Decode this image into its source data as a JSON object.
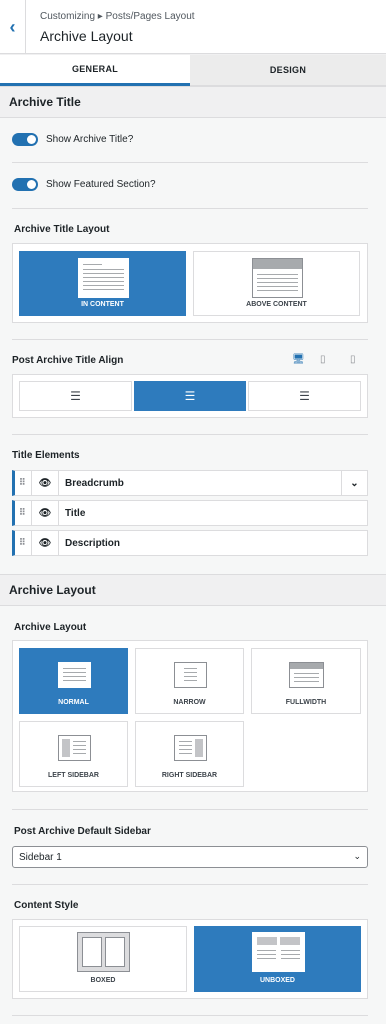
{
  "header": {
    "breadcrumb": "Customizing ▸ Posts/Pages Layout",
    "title": "Archive Layout",
    "back_icon": "chevron-left-icon"
  },
  "tabs": [
    {
      "label": "GENERAL",
      "active": true
    },
    {
      "label": "DESIGN",
      "active": false
    }
  ],
  "archive_title": {
    "section_title": "Archive Title",
    "show_archive_title": {
      "label": "Show Archive Title?",
      "on": true
    },
    "show_featured_section": {
      "label": "Show Featured Section?",
      "on": true
    },
    "layout": {
      "label": "Archive Title Layout",
      "options": [
        {
          "label": "IN CONTENT",
          "selected": true
        },
        {
          "label": "ABOVE CONTENT",
          "selected": false
        }
      ]
    },
    "align": {
      "label": "Post Archive Title Align",
      "options": [
        "left",
        "center",
        "right"
      ],
      "selected": "center",
      "devices": [
        "desktop-icon",
        "tablet-icon",
        "mobile-icon"
      ]
    },
    "elements": {
      "label": "Title Elements",
      "items": [
        "Breadcrumb",
        "Title",
        "Description"
      ]
    }
  },
  "archive_layout": {
    "section_title": "Archive Layout",
    "layout": {
      "label": "Archive Layout",
      "options": [
        {
          "label": "NORMAL",
          "selected": true
        },
        {
          "label": "NARROW",
          "selected": false
        },
        {
          "label": "FULLWIDTH",
          "selected": false
        },
        {
          "label": "LEFT SIDEBAR",
          "selected": false
        },
        {
          "label": "RIGHT SIDEBAR",
          "selected": false
        }
      ]
    },
    "sidebar": {
      "label": "Post Archive Default Sidebar",
      "value": "Sidebar 1"
    },
    "content_style": {
      "label": "Content Style",
      "options": [
        {
          "label": "BOXED",
          "selected": false
        },
        {
          "label": "UNBOXED",
          "selected": true
        }
      ]
    }
  },
  "colors": {
    "accent": "#2e7bbd",
    "toggle": "#2271b1"
  }
}
